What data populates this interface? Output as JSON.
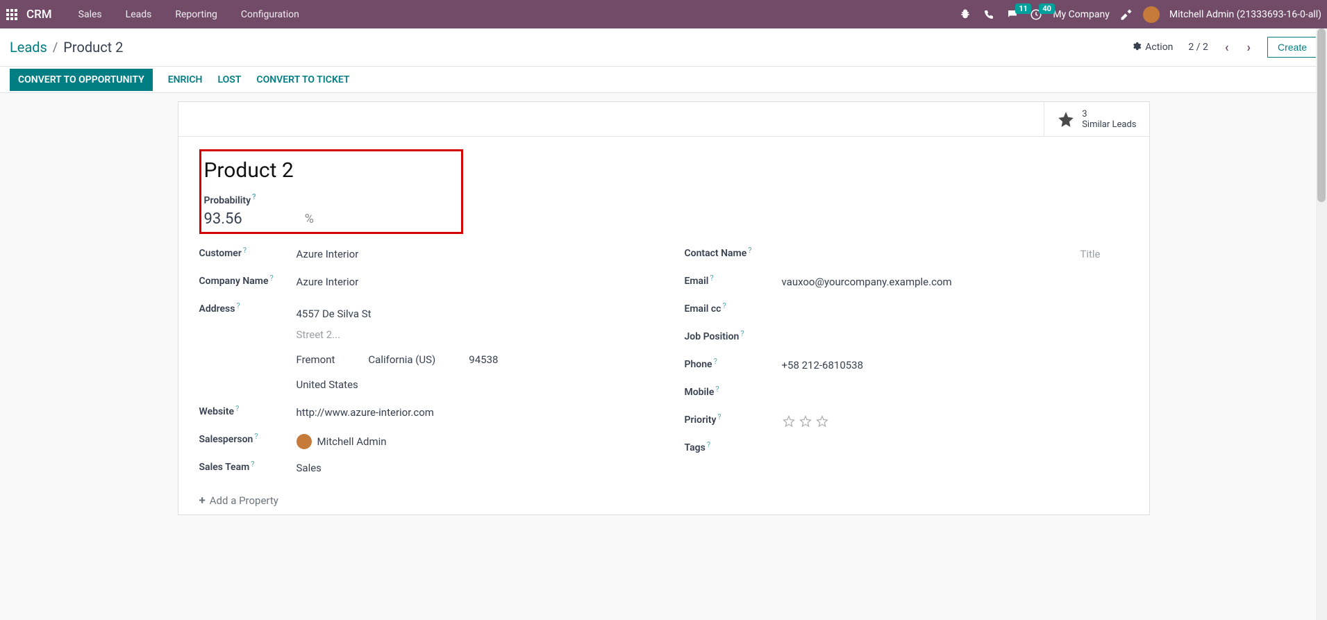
{
  "nav": {
    "brand": "CRM",
    "links": [
      "Sales",
      "Leads",
      "Reporting",
      "Configuration"
    ],
    "msg_badge": "11",
    "clock_badge": "40",
    "company": "My Company",
    "user": "Mitchell Admin (21333693-16-0-all)"
  },
  "subheader": {
    "crumb_parent": "Leads",
    "crumb_current": "Product 2",
    "action": "Action",
    "pager": "2 / 2",
    "create": "Create"
  },
  "statusbar": {
    "convert": "CONVERT TO OPPORTUNITY",
    "enrich": "ENRICH",
    "lost": "LOST",
    "ticket": "CONVERT TO TICKET"
  },
  "smart": {
    "count": "3",
    "label": "Similar Leads"
  },
  "lead": {
    "title": "Product 2",
    "probability": {
      "label": "Probability",
      "value": "93.56",
      "pct": "%"
    }
  },
  "left": {
    "customer": {
      "label": "Customer",
      "value": "Azure Interior"
    },
    "company": {
      "label": "Company Name",
      "value": "Azure Interior"
    },
    "address": {
      "label": "Address",
      "street": "4557 De Silva St",
      "street2_placeholder": "Street 2...",
      "city": "Fremont",
      "state": "California (US)",
      "zip": "94538",
      "country": "United States"
    },
    "website": {
      "label": "Website",
      "value": "http://www.azure-interior.com"
    },
    "salesperson": {
      "label": "Salesperson",
      "value": "Mitchell Admin"
    },
    "team": {
      "label": "Sales Team",
      "value": "Sales"
    },
    "add_property": "Add a Property"
  },
  "right": {
    "contact": {
      "label": "Contact Name",
      "title_placeholder": "Title"
    },
    "email": {
      "label": "Email",
      "value": "vauxoo@yourcompany.example.com"
    },
    "emailcc": {
      "label": "Email cc"
    },
    "job": {
      "label": "Job Position"
    },
    "phone": {
      "label": "Phone",
      "value": "+58 212-6810538"
    },
    "mobile": {
      "label": "Mobile"
    },
    "priority": {
      "label": "Priority"
    },
    "tags": {
      "label": "Tags"
    }
  }
}
